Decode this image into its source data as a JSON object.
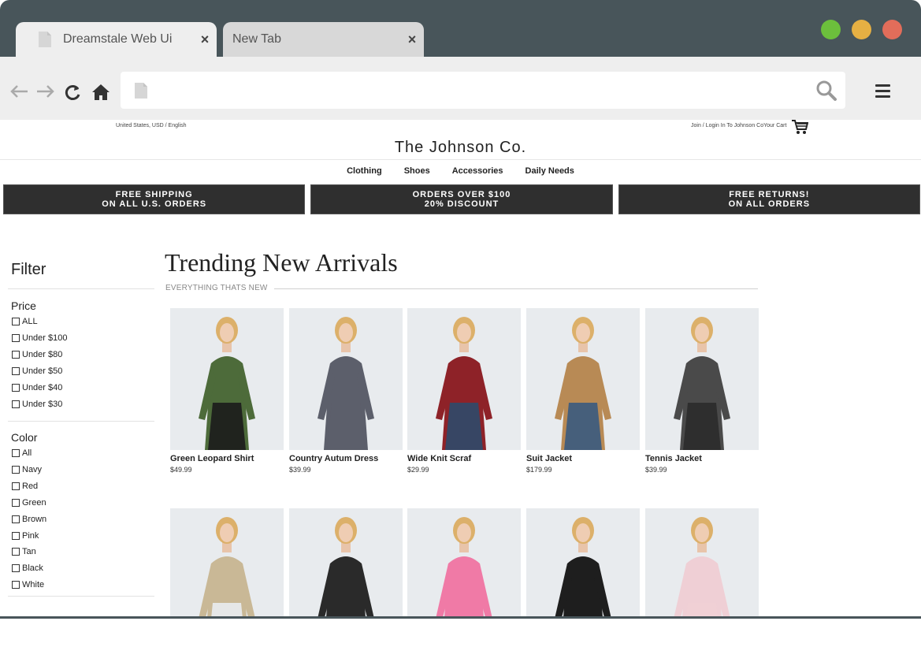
{
  "browser": {
    "tabs": [
      {
        "label": "Dreamstale Web Ui",
        "active": true
      },
      {
        "label": "New Tab",
        "active": false
      }
    ],
    "close_glyph": "×",
    "window_dots": [
      "#6cbf3c",
      "#e6b043",
      "#e26d5a"
    ],
    "url": ""
  },
  "site": {
    "locale": "United States, USD / English",
    "account": "Join / Login In To Johnson CoYour Cart",
    "brand": "The Johnson Co.",
    "nav": [
      "Clothing",
      "Shoes",
      "Accessories",
      "Daily Needs"
    ],
    "promos": [
      {
        "line1": "FREE SHIPPING",
        "line2": "ON ALL U.S. ORDERS"
      },
      {
        "line1": "ORDERS OVER $100",
        "line2": "20% DISCOUNT"
      },
      {
        "line1": "FREE RETURNS!",
        "line2": "ON ALL ORDERS"
      }
    ]
  },
  "filter": {
    "title": "Filter",
    "price": {
      "title": "Price",
      "options": [
        "ALL",
        "Under $100",
        "Under $80",
        "Under $50",
        "Under $40",
        "Under $30"
      ]
    },
    "color": {
      "title": "Color",
      "options": [
        "All",
        "Navy",
        "Red",
        "Green",
        "Brown",
        "Pink",
        "Tan",
        "Black",
        "White"
      ]
    }
  },
  "main": {
    "title": "Trending New Arrivals",
    "subtitle": "EVERYTHING THATS NEW",
    "products": [
      {
        "name": "Green Leopard Shirt",
        "price": "$49.99",
        "top": "#4d6b3a",
        "bottom": "#1c1c1c"
      },
      {
        "name": "Country Autum Dress",
        "price": "$39.99",
        "top": "#5c5f6b",
        "bottom": "#5c5f6b"
      },
      {
        "name": "Wide Knit Scraf",
        "price": "$29.99",
        "top": "#8e2228",
        "bottom": "#2d4a6a"
      },
      {
        "name": "Suit Jacket",
        "price": "$179.99",
        "top": "#b88a55",
        "bottom": "#3a5a80"
      },
      {
        "name": "Tennis Jacket",
        "price": "$39.99",
        "top": "#4a4a4a",
        "bottom": "#2b2b2b"
      }
    ],
    "products_row2": [
      {
        "top": "#c9b896",
        "bottom": "#e9ecef"
      },
      {
        "top": "#2a2a2a",
        "bottom": "#2a2a2a"
      },
      {
        "top": "#f07aa6",
        "bottom": "#f07aa6"
      },
      {
        "top": "#1e1e1e",
        "bottom": "#1e1e1e"
      },
      {
        "top": "#efcfd5",
        "bottom": "#efcfd5"
      }
    ]
  }
}
